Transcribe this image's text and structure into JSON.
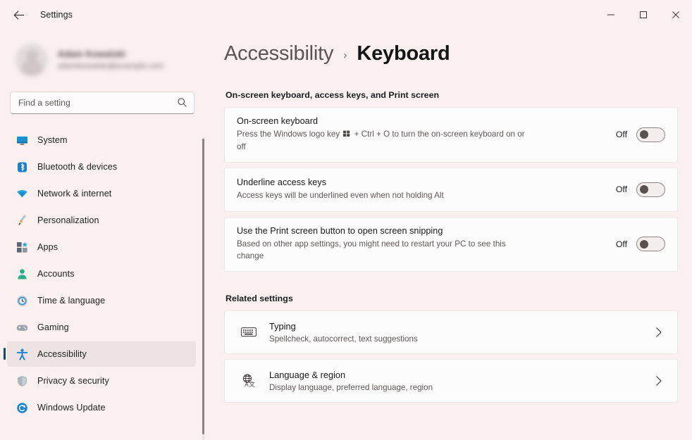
{
  "window": {
    "app_title": "Settings",
    "back_icon": "back-arrow-icon",
    "controls": {
      "minimize": "minimize-icon",
      "maximize": "maximize-icon",
      "close": "close-icon"
    }
  },
  "sidebar": {
    "profile": {
      "name": "Adam Kowalski",
      "email": "adamkowalski@example.com",
      "avatar": "user-avatar"
    },
    "search": {
      "placeholder": "Find a setting",
      "value": "",
      "icon": "search-icon"
    },
    "items": [
      {
        "label": "System",
        "icon": "monitor-icon",
        "selected": false
      },
      {
        "label": "Bluetooth & devices",
        "icon": "bluetooth-icon",
        "selected": false
      },
      {
        "label": "Network & internet",
        "icon": "wifi-icon",
        "selected": false
      },
      {
        "label": "Personalization",
        "icon": "paintbrush-icon",
        "selected": false
      },
      {
        "label": "Apps",
        "icon": "apps-grid-icon",
        "selected": false
      },
      {
        "label": "Accounts",
        "icon": "person-icon",
        "selected": false
      },
      {
        "label": "Time & language",
        "icon": "clock-globe-icon",
        "selected": false
      },
      {
        "label": "Gaming",
        "icon": "gamepad-icon",
        "selected": false
      },
      {
        "label": "Accessibility",
        "icon": "accessibility-person-icon",
        "selected": true
      },
      {
        "label": "Privacy & security",
        "icon": "shield-icon",
        "selected": false
      },
      {
        "label": "Windows Update",
        "icon": "update-refresh-icon",
        "selected": false
      }
    ]
  },
  "main": {
    "breadcrumb": {
      "parent": "Accessibility",
      "separator": "›",
      "current": "Keyboard"
    },
    "section_one": {
      "heading": "On-screen keyboard, access keys, and Print screen",
      "settings": [
        {
          "title": "On-screen keyboard",
          "desc_before": "Press the Windows logo key",
          "desc_after": "+ Ctrl + O to turn the on-screen keyboard on or off",
          "state": "Off",
          "toggle_on": false
        },
        {
          "title": "Underline access keys",
          "desc": "Access keys will be underlined even when not holding Alt",
          "state": "Off",
          "toggle_on": false
        },
        {
          "title": "Use the Print screen button to open screen snipping",
          "desc": "Based on other app settings, you might need to restart your PC to see this change",
          "state": "Off",
          "toggle_on": false
        }
      ]
    },
    "section_two": {
      "heading": "Related settings",
      "links": [
        {
          "title": "Typing",
          "desc": "Spellcheck, autocorrect, text suggestions",
          "icon": "keyboard-icon",
          "chevron": "chevron-right-icon"
        },
        {
          "title": "Language & region",
          "desc": "Display language, preferred language, region",
          "icon": "language-globe-icon",
          "chevron": "chevron-right-icon"
        }
      ]
    }
  },
  "colors": {
    "page_background": "#f9f0ef",
    "card_background": "#fdfcfc",
    "selection_indicator": "#13457a",
    "selected_row": "#ece3e2",
    "accent_blue": "#0a7cc4"
  }
}
